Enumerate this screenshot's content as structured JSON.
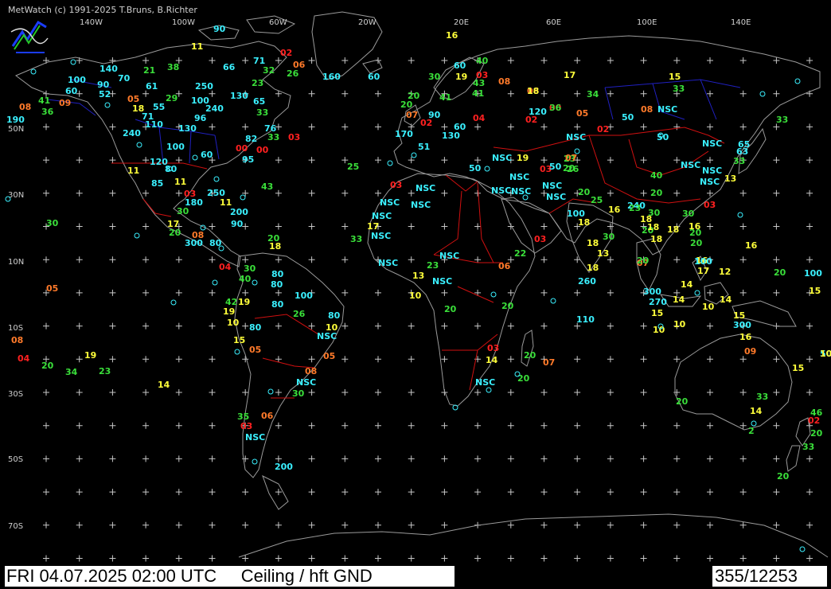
{
  "header": {
    "copyright": "MetWatch  (c) 1991-2025 T.Bruns, B.Richter"
  },
  "footer": {
    "title": "FRI 04.07.2025 02:00 UTC     Ceiling / hft GND",
    "counter": "355/12253"
  },
  "grid": {
    "lon_labels": [
      "140W",
      "100W",
      "60W",
      "20W",
      "20E",
      "60E",
      "100E",
      "140E"
    ],
    "lat_labels": [
      "50N",
      "30N",
      "10N",
      "10S",
      "30S",
      "50S",
      "70S"
    ]
  },
  "colors": {
    "background": "#000000",
    "coastline": "#9a9a9a",
    "country_border": "#d01010",
    "state_border": "#2020c0",
    "grid_cross": "#c8c8c8",
    "red": "#ff2020",
    "orange": "#ff7a2a",
    "yellow": "#ffff3a",
    "green": "#3adf3a",
    "cyan": "#3af0ff"
  },
  "stations": [
    {
      "t": "16",
      "c": "yellow"
    },
    {
      "t": "90",
      "c": "cyan"
    },
    {
      "t": "11",
      "c": "yellow"
    },
    {
      "t": "02",
      "c": "red"
    },
    {
      "t": "06",
      "c": "orange"
    },
    {
      "t": "71",
      "c": "cyan"
    },
    {
      "t": "32",
      "c": "green"
    },
    {
      "t": "26",
      "c": "green"
    },
    {
      "t": "160",
      "c": "cyan"
    },
    {
      "t": "60",
      "c": "cyan"
    },
    {
      "t": "140",
      "c": "cyan"
    },
    {
      "t": "21",
      "c": "green"
    },
    {
      "t": "38",
      "c": "green"
    },
    {
      "t": "66",
      "c": "cyan"
    },
    {
      "t": "100",
      "c": "cyan"
    },
    {
      "t": "70",
      "c": "cyan"
    },
    {
      "t": "90",
      "c": "cyan"
    },
    {
      "t": "52",
      "c": "cyan"
    },
    {
      "t": "61",
      "c": "cyan"
    },
    {
      "t": "250",
      "c": "cyan"
    },
    {
      "t": "23",
      "c": "green"
    },
    {
      "t": "60",
      "c": "cyan"
    },
    {
      "t": "41",
      "c": "green"
    },
    {
      "t": "08",
      "c": "orange"
    },
    {
      "t": "09",
      "c": "orange"
    },
    {
      "t": "36",
      "c": "green"
    },
    {
      "t": "190",
      "c": "cyan"
    },
    {
      "t": "05",
      "c": "orange"
    },
    {
      "t": "18",
      "c": "yellow"
    },
    {
      "t": "55",
      "c": "cyan"
    },
    {
      "t": "29",
      "c": "green"
    },
    {
      "t": "100",
      "c": "cyan"
    },
    {
      "t": "130",
      "c": "cyan"
    },
    {
      "t": "65",
      "c": "cyan"
    },
    {
      "t": "240",
      "c": "cyan"
    },
    {
      "t": "71",
      "c": "cyan"
    },
    {
      "t": "96",
      "c": "cyan"
    },
    {
      "t": "33",
      "c": "green"
    },
    {
      "t": "110",
      "c": "cyan"
    },
    {
      "t": "130",
      "c": "cyan"
    },
    {
      "t": "76",
      "c": "cyan"
    },
    {
      "t": "240",
      "c": "cyan"
    },
    {
      "t": "82",
      "c": "cyan"
    },
    {
      "t": "33",
      "c": "green"
    },
    {
      "t": "03",
      "c": "red"
    },
    {
      "t": "100",
      "c": "cyan"
    },
    {
      "t": "60",
      "c": "cyan"
    },
    {
      "t": "00",
      "c": "red"
    },
    {
      "t": "00",
      "c": "red"
    },
    {
      "t": "95",
      "c": "cyan"
    },
    {
      "t": "120",
      "c": "cyan"
    },
    {
      "t": "80",
      "c": "cyan"
    },
    {
      "t": "11",
      "c": "yellow"
    },
    {
      "t": "25",
      "c": "green"
    },
    {
      "t": "85",
      "c": "cyan"
    },
    {
      "t": "11",
      "c": "yellow"
    },
    {
      "t": "03",
      "c": "red"
    },
    {
      "t": "250",
      "c": "cyan"
    },
    {
      "t": "43",
      "c": "green"
    },
    {
      "t": "180",
      "c": "cyan"
    },
    {
      "t": "11",
      "c": "yellow"
    },
    {
      "t": "30",
      "c": "green"
    },
    {
      "t": "200",
      "c": "cyan"
    },
    {
      "t": "30",
      "c": "green"
    },
    {
      "t": "17",
      "c": "yellow"
    },
    {
      "t": "90",
      "c": "cyan"
    },
    {
      "t": "20",
      "c": "green"
    },
    {
      "t": "08",
      "c": "orange"
    },
    {
      "t": "300",
      "c": "cyan"
    },
    {
      "t": "80",
      "c": "cyan"
    },
    {
      "t": "20",
      "c": "green"
    },
    {
      "t": "18",
      "c": "yellow"
    },
    {
      "t": "04",
      "c": "red"
    },
    {
      "t": "30",
      "c": "green"
    },
    {
      "t": "80",
      "c": "cyan"
    },
    {
      "t": "40",
      "c": "green"
    },
    {
      "t": "80",
      "c": "cyan"
    },
    {
      "t": "19",
      "c": "yellow"
    },
    {
      "t": "42",
      "c": "green"
    },
    {
      "t": "80",
      "c": "cyan"
    },
    {
      "t": "100",
      "c": "cyan"
    },
    {
      "t": "26",
      "c": "green"
    },
    {
      "t": "80",
      "c": "cyan"
    },
    {
      "t": "19",
      "c": "yellow"
    },
    {
      "t": "10",
      "c": "yellow"
    },
    {
      "t": "80",
      "c": "cyan"
    },
    {
      "t": "15",
      "c": "yellow"
    },
    {
      "t": "10",
      "c": "yellow"
    },
    {
      "t": "NSC",
      "c": "cyan"
    },
    {
      "t": "05",
      "c": "orange"
    },
    {
      "t": "05",
      "c": "orange"
    },
    {
      "t": "08",
      "c": "orange"
    },
    {
      "t": "NSC",
      "c": "cyan"
    },
    {
      "t": "30",
      "c": "green"
    },
    {
      "t": "35",
      "c": "green"
    },
    {
      "t": "06",
      "c": "orange"
    },
    {
      "t": "03",
      "c": "red"
    },
    {
      "t": "NSC",
      "c": "cyan"
    },
    {
      "t": "200",
      "c": "cyan"
    },
    {
      "t": "05",
      "c": "orange"
    },
    {
      "t": "08",
      "c": "orange"
    },
    {
      "t": "04",
      "c": "red"
    },
    {
      "t": "19",
      "c": "yellow"
    },
    {
      "t": "20",
      "c": "green"
    },
    {
      "t": "34",
      "c": "green"
    },
    {
      "t": "23",
      "c": "green"
    },
    {
      "t": "14",
      "c": "yellow"
    },
    {
      "t": "60",
      "c": "cyan"
    },
    {
      "t": "40",
      "c": "green"
    },
    {
      "t": "30",
      "c": "green"
    },
    {
      "t": "19",
      "c": "yellow"
    },
    {
      "t": "03",
      "c": "red"
    },
    {
      "t": "43",
      "c": "green"
    },
    {
      "t": "08",
      "c": "orange"
    },
    {
      "t": "41",
      "c": "green"
    },
    {
      "t": "41",
      "c": "green"
    },
    {
      "t": "20",
      "c": "green"
    },
    {
      "t": "06",
      "c": "orange"
    },
    {
      "t": "20",
      "c": "green"
    },
    {
      "t": "07",
      "c": "orange"
    },
    {
      "t": "90",
      "c": "cyan"
    },
    {
      "t": "04",
      "c": "red"
    },
    {
      "t": "02",
      "c": "red"
    },
    {
      "t": "60",
      "c": "cyan"
    },
    {
      "t": "130",
      "c": "cyan"
    },
    {
      "t": "170",
      "c": "cyan"
    },
    {
      "t": "51",
      "c": "cyan"
    },
    {
      "t": "00",
      "c": "red"
    },
    {
      "t": "120",
      "c": "cyan"
    },
    {
      "t": "02",
      "c": "red"
    },
    {
      "t": "NSC",
      "c": "cyan"
    },
    {
      "t": "19",
      "c": "yellow"
    },
    {
      "t": "50",
      "c": "cyan"
    },
    {
      "t": "03",
      "c": "red"
    },
    {
      "t": "23",
      "c": "green"
    },
    {
      "t": "20",
      "c": "green"
    },
    {
      "t": "03",
      "c": "red"
    },
    {
      "t": "NSC",
      "c": "cyan"
    },
    {
      "t": "NSC",
      "c": "cyan"
    },
    {
      "t": "NSC",
      "c": "cyan"
    },
    {
      "t": "NSC",
      "c": "cyan"
    },
    {
      "t": "NSC",
      "c": "cyan"
    },
    {
      "t": "NSC",
      "c": "cyan"
    },
    {
      "t": "NSC",
      "c": "cyan"
    },
    {
      "t": "NSC",
      "c": "cyan"
    },
    {
      "t": "NSC",
      "c": "cyan"
    },
    {
      "t": "17",
      "c": "yellow"
    },
    {
      "t": "NSC",
      "c": "cyan"
    },
    {
      "t": "33",
      "c": "green"
    },
    {
      "t": "NSC",
      "c": "cyan"
    },
    {
      "t": "NSC",
      "c": "cyan"
    },
    {
      "t": "23",
      "c": "green"
    },
    {
      "t": "13",
      "c": "yellow"
    },
    {
      "t": "NSC",
      "c": "cyan"
    },
    {
      "t": "10",
      "c": "yellow"
    },
    {
      "t": "06",
      "c": "orange"
    },
    {
      "t": "03",
      "c": "red"
    },
    {
      "t": "22",
      "c": "green"
    },
    {
      "t": "20",
      "c": "green"
    },
    {
      "t": "20",
      "c": "green"
    },
    {
      "t": "03",
      "c": "red"
    },
    {
      "t": "14",
      "c": "yellow"
    },
    {
      "t": "20",
      "c": "green"
    },
    {
      "t": "07",
      "c": "orange"
    },
    {
      "t": "20",
      "c": "green"
    },
    {
      "t": "NSC",
      "c": "cyan"
    },
    {
      "t": "17",
      "c": "yellow"
    },
    {
      "t": "15",
      "c": "yellow"
    },
    {
      "t": "33",
      "c": "green"
    },
    {
      "t": "34",
      "c": "green"
    },
    {
      "t": "18",
      "c": "yellow"
    },
    {
      "t": "36",
      "c": "green"
    },
    {
      "t": "05",
      "c": "orange"
    },
    {
      "t": "08",
      "c": "orange"
    },
    {
      "t": "02",
      "c": "red"
    },
    {
      "t": "50",
      "c": "cyan"
    },
    {
      "t": "33",
      "c": "green"
    },
    {
      "t": "NSC",
      "c": "cyan"
    },
    {
      "t": "NSC",
      "c": "cyan"
    },
    {
      "t": "50",
      "c": "cyan"
    },
    {
      "t": "65",
      "c": "cyan"
    },
    {
      "t": "NSC",
      "c": "cyan"
    },
    {
      "t": "63",
      "c": "cyan"
    },
    {
      "t": "33",
      "c": "green"
    },
    {
      "t": "07",
      "c": "orange"
    },
    {
      "t": "26",
      "c": "green"
    },
    {
      "t": "50",
      "c": "cyan"
    },
    {
      "t": "40",
      "c": "green"
    },
    {
      "t": "NSC",
      "c": "cyan"
    },
    {
      "t": "NSC",
      "c": "cyan"
    },
    {
      "t": "NSC",
      "c": "cyan"
    },
    {
      "t": "13",
      "c": "yellow"
    },
    {
      "t": "20",
      "c": "green"
    },
    {
      "t": "20",
      "c": "green"
    },
    {
      "t": "03",
      "c": "red"
    },
    {
      "t": "25",
      "c": "green"
    },
    {
      "t": "100",
      "c": "cyan"
    },
    {
      "t": "16",
      "c": "yellow"
    },
    {
      "t": "240",
      "c": "cyan"
    },
    {
      "t": "30",
      "c": "green"
    },
    {
      "t": "30",
      "c": "green"
    },
    {
      "t": "18",
      "c": "yellow"
    },
    {
      "t": "18",
      "c": "yellow"
    },
    {
      "t": "23",
      "c": "green"
    },
    {
      "t": "30",
      "c": "green"
    },
    {
      "t": "20",
      "c": "green"
    },
    {
      "t": "20",
      "c": "green"
    },
    {
      "t": "18",
      "c": "yellow"
    },
    {
      "t": "16",
      "c": "yellow"
    },
    {
      "t": "18",
      "c": "yellow"
    },
    {
      "t": "18",
      "c": "yellow"
    },
    {
      "t": "13",
      "c": "yellow"
    },
    {
      "t": "20",
      "c": "green"
    },
    {
      "t": "18",
      "c": "yellow"
    },
    {
      "t": "07",
      "c": "orange"
    },
    {
      "t": "16",
      "c": "yellow"
    },
    {
      "t": "16",
      "c": "yellow"
    },
    {
      "t": "18",
      "c": "yellow"
    },
    {
      "t": "20",
      "c": "green"
    },
    {
      "t": "100",
      "c": "cyan"
    },
    {
      "t": "17",
      "c": "yellow"
    },
    {
      "t": "12",
      "c": "yellow"
    },
    {
      "t": "20",
      "c": "green"
    },
    {
      "t": "100",
      "c": "cyan"
    },
    {
      "t": "260",
      "c": "cyan"
    },
    {
      "t": "14",
      "c": "yellow"
    },
    {
      "t": "300",
      "c": "cyan"
    },
    {
      "t": "14",
      "c": "yellow"
    },
    {
      "t": "270",
      "c": "cyan"
    },
    {
      "t": "15",
      "c": "yellow"
    },
    {
      "t": "10",
      "c": "yellow"
    },
    {
      "t": "10",
      "c": "yellow"
    },
    {
      "t": "15",
      "c": "yellow"
    },
    {
      "t": "14",
      "c": "yellow"
    },
    {
      "t": "10",
      "c": "yellow"
    },
    {
      "t": "15",
      "c": "yellow"
    },
    {
      "t": "300",
      "c": "cyan"
    },
    {
      "t": "110",
      "c": "cyan"
    },
    {
      "t": "16",
      "c": "yellow"
    },
    {
      "t": "09",
      "c": "orange"
    },
    {
      "t": "15",
      "c": "yellow"
    },
    {
      "t": "50",
      "c": "cyan"
    },
    {
      "t": "20",
      "c": "green"
    },
    {
      "t": "33",
      "c": "green"
    },
    {
      "t": "14",
      "c": "yellow"
    },
    {
      "t": "2",
      "c": "green"
    },
    {
      "t": "46",
      "c": "green"
    },
    {
      "t": "20",
      "c": "green"
    },
    {
      "t": "02",
      "c": "red"
    },
    {
      "t": "33",
      "c": "green"
    },
    {
      "t": "20",
      "c": "green"
    },
    {
      "t": "10",
      "c": "yellow"
    },
    {
      "t": "10",
      "c": "yellow"
    },
    {
      "t": "06",
      "c": "orange"
    },
    {
      "t": "10",
      "c": "yellow"
    },
    {
      "t": "2",
      "c": "green"
    }
  ]
}
